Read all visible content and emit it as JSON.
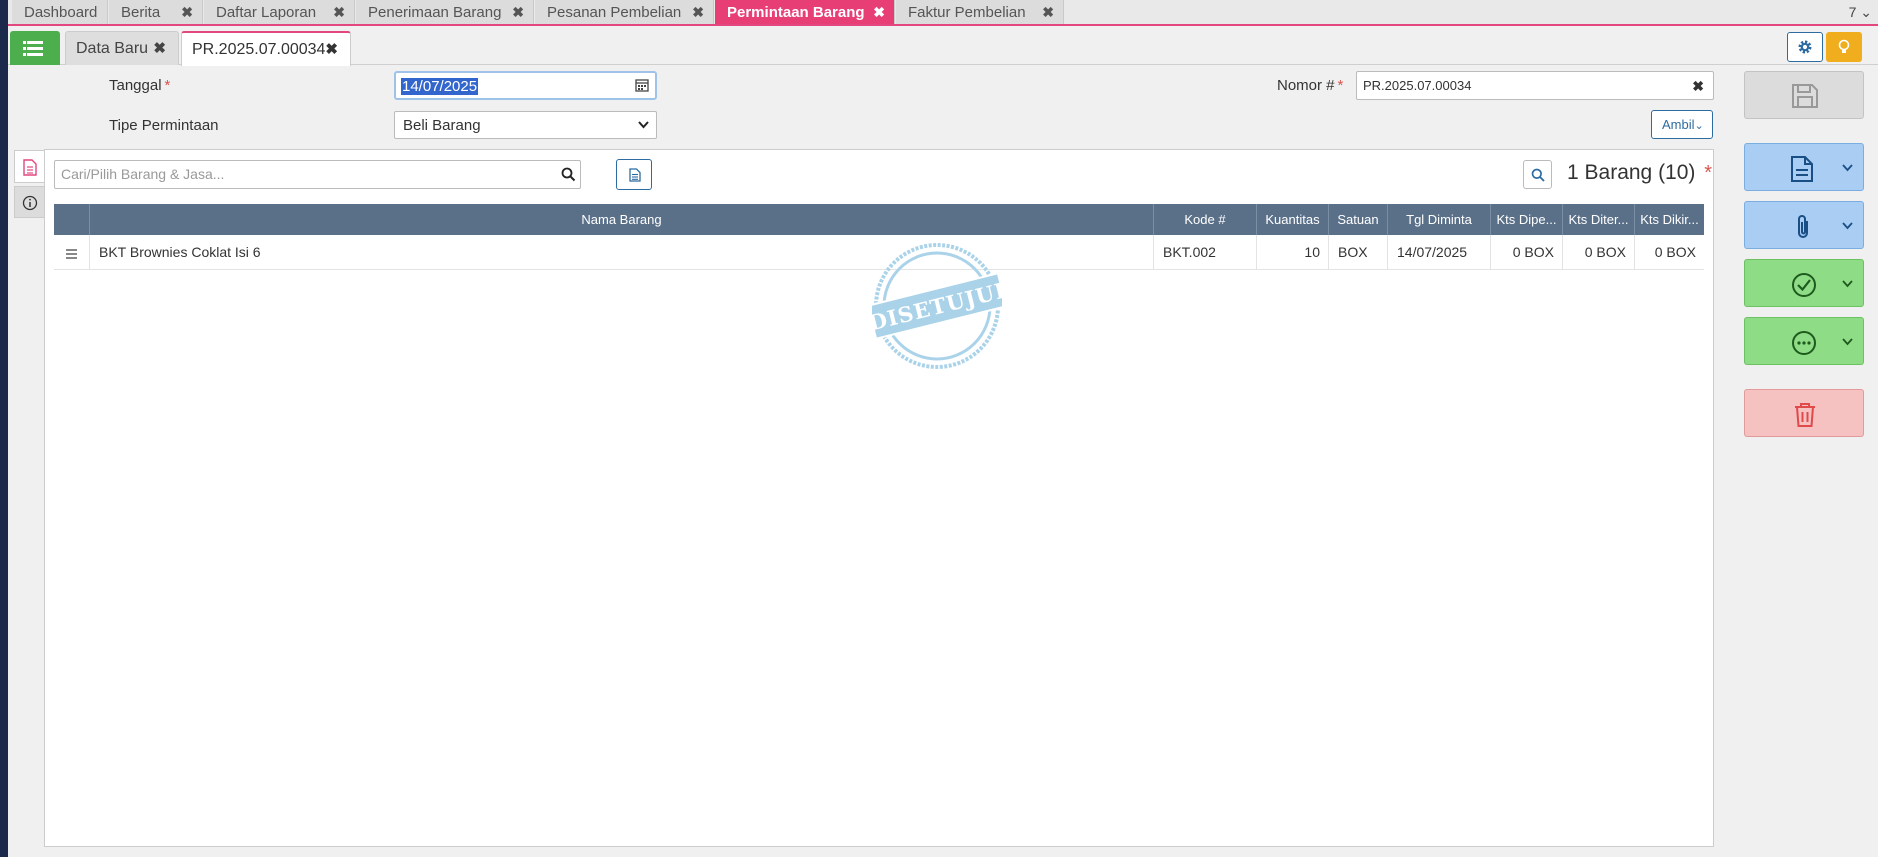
{
  "top_tabs": [
    {
      "label": "Dashboard"
    },
    {
      "label": "Berita"
    },
    {
      "label": "Daftar Laporan"
    },
    {
      "label": "Penerimaan Barang"
    },
    {
      "label": "Pesanan Pembelian"
    },
    {
      "label": "Permintaan Barang"
    },
    {
      "label": "Faktur Pembelian"
    }
  ],
  "top_tab_count": "7",
  "sub_tabs": [
    {
      "label": "Data Baru"
    },
    {
      "label": "PR.2025.07.00034"
    }
  ],
  "form": {
    "tanggal_label": "Tanggal",
    "tanggal_value": "14/07/2025",
    "tipe_label": "Tipe Permintaan",
    "tipe_value": "Beli Barang",
    "nomor_label": "Nomor #",
    "nomor_value": "PR.2025.07.00034",
    "ambil_label": "Ambil",
    "required_mark": "*"
  },
  "items_panel": {
    "search_placeholder": "Cari/Pilih Barang & Jasa...",
    "count_label": "1 Barang (10)",
    "stamp_text": "DISETUJUI",
    "columns": [
      "Nama Barang",
      "Kode #",
      "Kuantitas",
      "Satuan",
      "Tgl Diminta",
      "Kts Dipe...",
      "Kts Diter...",
      "Kts Dikir..."
    ],
    "rows": [
      {
        "nama": "BKT Brownies Coklat Isi 6",
        "kode": "BKT.002",
        "kuantitas": "10",
        "satuan": "BOX",
        "tgl": "14/07/2025",
        "kts_dipe": "0 BOX",
        "kts_diter": "0 BOX",
        "kts_dikir": "0 BOX"
      }
    ]
  },
  "colors": {
    "active_tab": "#e83e76",
    "header_row": "#5a7089",
    "menu_green": "#4cae4c",
    "action_blue": "#a9cdf3",
    "action_green": "#8fdc86",
    "action_red": "#f6c1c1"
  },
  "icons": [
    "menu-icon",
    "gear-icon",
    "bulb-icon",
    "calendar-icon",
    "chevron-down-icon",
    "search-icon",
    "document-icon",
    "info-icon",
    "save-icon",
    "paperclip-icon",
    "check-circle-icon",
    "more-icon",
    "trash-icon",
    "close-icon"
  ]
}
